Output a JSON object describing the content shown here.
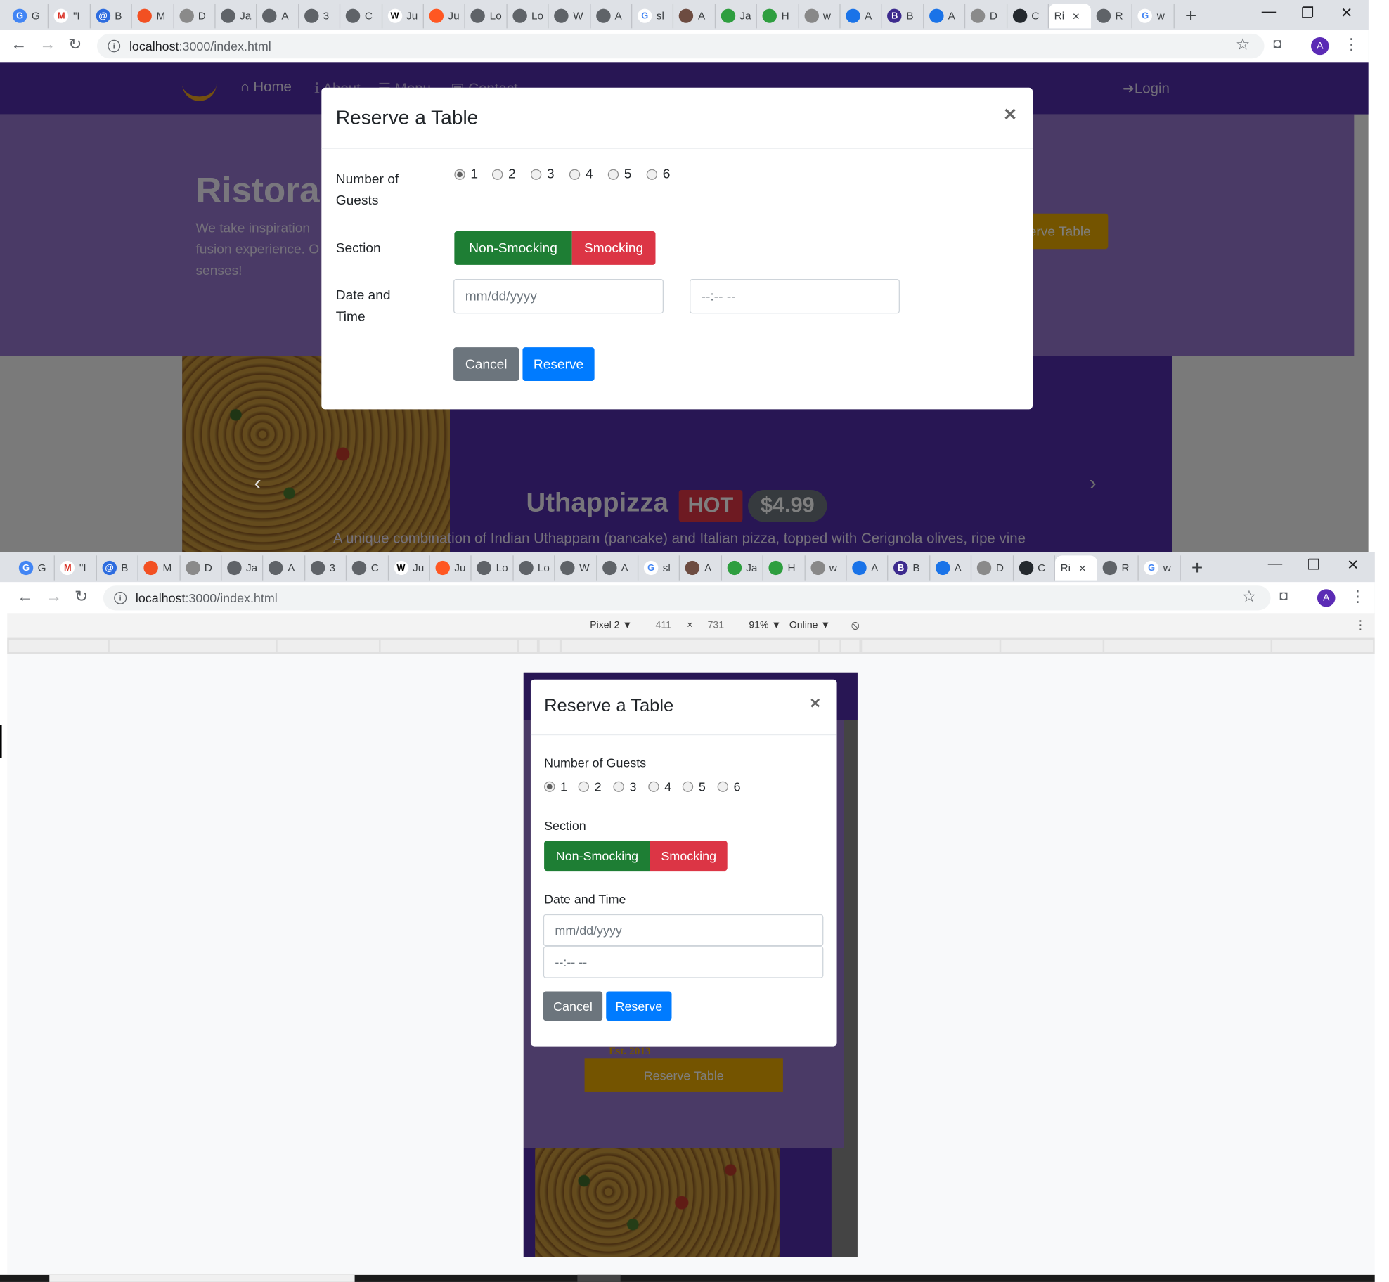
{
  "browser": {
    "tab_titles": [
      "G",
      "\"I",
      "B",
      "M",
      "D",
      "Ja",
      "A",
      "3",
      "C",
      "Ju",
      "Ju",
      "Lo",
      "Lo",
      "W",
      "A",
      "sl",
      "A",
      "Ja",
      "H",
      "w",
      "A",
      "B",
      "A",
      "D",
      "C",
      "Ri",
      "R",
      "w"
    ],
    "favicon_letters": [
      "G",
      "M",
      "@",
      "",
      "",
      "",
      "",
      "",
      "",
      "W",
      "",
      "",
      "",
      "",
      "",
      "G",
      "",
      "",
      "",
      "",
      "",
      "B",
      "",
      "",
      "",
      "",
      "",
      "G"
    ],
    "active_tab_close": "×",
    "new_tab": "+",
    "address_host": "localhost",
    "address_path": ":3000/index.html",
    "profile_initial": "A"
  },
  "site": {
    "nav_home": "Home",
    "nav_about": "About",
    "nav_menu": "Menu",
    "nav_contact": "Contact",
    "nav_login": "Login",
    "brand_title": "Ristorante con Fusion",
    "jumbo_text_1": "We take inspiration",
    "jumbo_text_2": "fusion experience. O",
    "jumbo_text_3": "senses!",
    "reserve_button": "Reserve Table",
    "dish_name": "Uthappizza",
    "dish_badge": "HOT",
    "dish_price": "$4.99",
    "dish_desc": "A unique combination of Indian Uthappam (pancake) and Italian pizza, topped with Cerignola olives, ripe vine",
    "est": "Est. 2013"
  },
  "modal": {
    "title": "Reserve a Table",
    "close": "×",
    "guests_label": "Number of Guests",
    "guests_label_line1": "Number of",
    "guests_label_line2": "Guests",
    "guest_options": [
      "1",
      "2",
      "3",
      "4",
      "5",
      "6"
    ],
    "section_label": "Section",
    "non_smoking": "Non-Smocking",
    "smoking": "Smocking",
    "datetime_label": "Date and Time",
    "datetime_label_line1": "Date and",
    "datetime_label_line2": "Time",
    "date_placeholder": "mm/dd/yyyy",
    "time_placeholder": "--:-- --",
    "cancel": "Cancel",
    "reserve": "Reserve"
  },
  "devtools": {
    "device": "Pixel 2 ▼",
    "width": "411",
    "times": "×",
    "height": "731",
    "zoom": "91% ▼",
    "network": "Online ▼"
  }
}
